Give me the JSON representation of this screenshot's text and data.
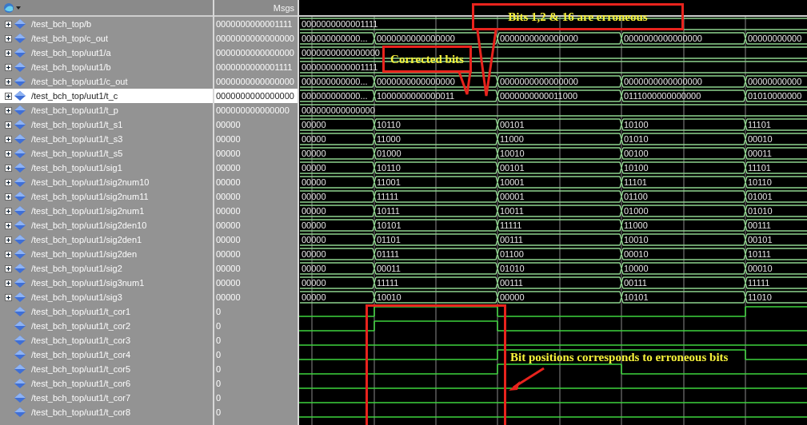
{
  "header": {
    "values_title": "Msgs"
  },
  "signals": [
    {
      "name": "/test_bch_top/b",
      "value": "0000000000001111",
      "kind": "bus",
      "selected": false,
      "segments": [
        "0000000000001111"
      ]
    },
    {
      "name": "/test_bch_top/c_out",
      "value": "0000000000000000",
      "kind": "bus",
      "selected": false,
      "segments": [
        "000000000000...",
        "0000000000000000",
        "0000000000000000",
        "0000000000000000",
        "00000000000"
      ]
    },
    {
      "name": "/test_bch_top/uut1/a",
      "value": "0000000000000000",
      "kind": "bus",
      "selected": false,
      "segments": [
        "0000000000000000"
      ]
    },
    {
      "name": "/test_bch_top/uut1/b",
      "value": "0000000000001111",
      "kind": "bus",
      "selected": false,
      "segments": [
        "0000000000001111"
      ]
    },
    {
      "name": "/test_bch_top/uut1/c_out",
      "value": "0000000000000000",
      "kind": "bus",
      "selected": false,
      "segments": [
        "000000000000...",
        "0000000000000000",
        "0000000000000000",
        "0000000000000000",
        "00000000000"
      ]
    },
    {
      "name": "/test_bch_top/uut1/t_c",
      "value": "0000000000000000",
      "kind": "bus",
      "selected": true,
      "segments": [
        "000000000000...",
        "1000000000000011",
        "0000000000011000",
        "0111000000000000",
        "01010000000"
      ]
    },
    {
      "name": "/test_bch_top/uut1/t_p",
      "value": "000000000000000",
      "kind": "bus",
      "selected": false,
      "segments": [
        "000000000000000"
      ]
    },
    {
      "name": "/test_bch_top/uut1/t_s1",
      "value": "00000",
      "kind": "bus",
      "selected": false,
      "segments": [
        "00000",
        "10110",
        "00101",
        "10100",
        "11101"
      ]
    },
    {
      "name": "/test_bch_top/uut1/t_s3",
      "value": "00000",
      "kind": "bus",
      "selected": false,
      "segments": [
        "00000",
        "11000",
        "11000",
        "01010",
        "00010"
      ]
    },
    {
      "name": "/test_bch_top/uut1/t_s5",
      "value": "00000",
      "kind": "bus",
      "selected": false,
      "segments": [
        "00000",
        "01000",
        "10010",
        "00100",
        "00011"
      ]
    },
    {
      "name": "/test_bch_top/uut1/sig1",
      "value": "00000",
      "kind": "bus",
      "selected": false,
      "segments": [
        "00000",
        "10110",
        "00101",
        "10100",
        "11101"
      ]
    },
    {
      "name": "/test_bch_top/uut1/sig2num10",
      "value": "00000",
      "kind": "bus",
      "selected": false,
      "segments": [
        "00000",
        "11001",
        "10001",
        "11101",
        "10110"
      ]
    },
    {
      "name": "/test_bch_top/uut1/sig2num11",
      "value": "00000",
      "kind": "bus",
      "selected": false,
      "segments": [
        "00000",
        "11111",
        "00001",
        "01100",
        "01001"
      ]
    },
    {
      "name": "/test_bch_top/uut1/sig2num1",
      "value": "00000",
      "kind": "bus",
      "selected": false,
      "segments": [
        "00000",
        "10111",
        "10011",
        "01000",
        "01010"
      ]
    },
    {
      "name": "/test_bch_top/uut1/sig2den10",
      "value": "00000",
      "kind": "bus",
      "selected": false,
      "segments": [
        "00000",
        "10101",
        "11111",
        "11000",
        "00111"
      ]
    },
    {
      "name": "/test_bch_top/uut1/sig2den1",
      "value": "00000",
      "kind": "bus",
      "selected": false,
      "segments": [
        "00000",
        "01101",
        "00111",
        "10010",
        "00101"
      ]
    },
    {
      "name": "/test_bch_top/uut1/sig2den",
      "value": "00000",
      "kind": "bus",
      "selected": false,
      "segments": [
        "00000",
        "01111",
        "01100",
        "00010",
        "10111"
      ]
    },
    {
      "name": "/test_bch_top/uut1/sig2",
      "value": "00000",
      "kind": "bus",
      "selected": false,
      "segments": [
        "00000",
        "00011",
        "01010",
        "10000",
        "00010"
      ]
    },
    {
      "name": "/test_bch_top/uut1/sig3num1",
      "value": "00000",
      "kind": "bus",
      "selected": false,
      "segments": [
        "00000",
        "11111",
        "00111",
        "00111",
        "11111"
      ]
    },
    {
      "name": "/test_bch_top/uut1/sig3",
      "value": "00000",
      "kind": "bus",
      "selected": false,
      "segments": [
        "00000",
        "10010",
        "00000",
        "10101",
        "11010"
      ]
    },
    {
      "name": "/test_bch_top/uut1/t_cor1",
      "value": "0",
      "kind": "bit",
      "selected": false
    },
    {
      "name": "/test_bch_top/uut1/t_cor2",
      "value": "0",
      "kind": "bit",
      "selected": false
    },
    {
      "name": "/test_bch_top/uut1/t_cor3",
      "value": "0",
      "kind": "bit",
      "selected": false
    },
    {
      "name": "/test_bch_top/uut1/t_cor4",
      "value": "0",
      "kind": "bit",
      "selected": false
    },
    {
      "name": "/test_bch_top/uut1/t_cor5",
      "value": "0",
      "kind": "bit",
      "selected": false
    },
    {
      "name": "/test_bch_top/uut1/t_cor6",
      "value": "0",
      "kind": "bit",
      "selected": false
    },
    {
      "name": "/test_bch_top/uut1/t_cor7",
      "value": "0",
      "kind": "bit",
      "selected": false
    },
    {
      "name": "/test_bch_top/uut1/t_cor8",
      "value": "0",
      "kind": "bit",
      "selected": false
    }
  ],
  "annotations": [
    {
      "kind": "top",
      "text": "Bits 1,2 & 16 are erroneous"
    },
    {
      "kind": "corrected",
      "text": "Corrected bits"
    },
    {
      "kind": "positions",
      "text": "Bit positions  corresponds to erroneous bits"
    }
  ]
}
